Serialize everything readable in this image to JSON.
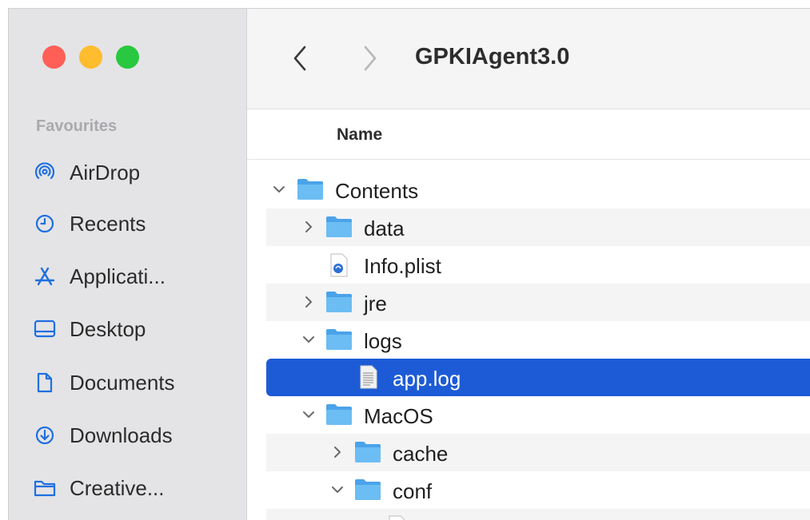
{
  "window": {
    "title": "GPKIAgent3.0"
  },
  "sidebar": {
    "heading": "Favourites",
    "items": [
      {
        "label": "AirDrop",
        "icon": "airdrop-icon"
      },
      {
        "label": "Recents",
        "icon": "clock-icon"
      },
      {
        "label": "Applicati...",
        "icon": "applications-icon"
      },
      {
        "label": "Desktop",
        "icon": "desktop-icon"
      },
      {
        "label": "Documents",
        "icon": "document-icon"
      },
      {
        "label": "Downloads",
        "icon": "download-icon"
      },
      {
        "label": "Creative...",
        "icon": "folder-icon"
      }
    ]
  },
  "columns": {
    "name": "Name"
  },
  "files": [
    {
      "name": "Contents",
      "type": "folder",
      "expanded": true
    },
    {
      "name": "data",
      "type": "folder",
      "expanded": false
    },
    {
      "name": "Info.plist",
      "type": "plist"
    },
    {
      "name": "jre",
      "type": "folder",
      "expanded": false
    },
    {
      "name": "logs",
      "type": "folder",
      "expanded": true
    },
    {
      "name": "app.log",
      "type": "log",
      "selected": true
    },
    {
      "name": "MacOS",
      "type": "folder",
      "expanded": true
    },
    {
      "name": "cache",
      "type": "folder",
      "expanded": false
    },
    {
      "name": "conf",
      "type": "folder",
      "expanded": true
    }
  ],
  "colors": {
    "selection": "#1d5bd6",
    "folder": "#5ab0ef",
    "close": "#ff5f57",
    "minimize": "#febc2e",
    "zoom": "#28c840"
  }
}
